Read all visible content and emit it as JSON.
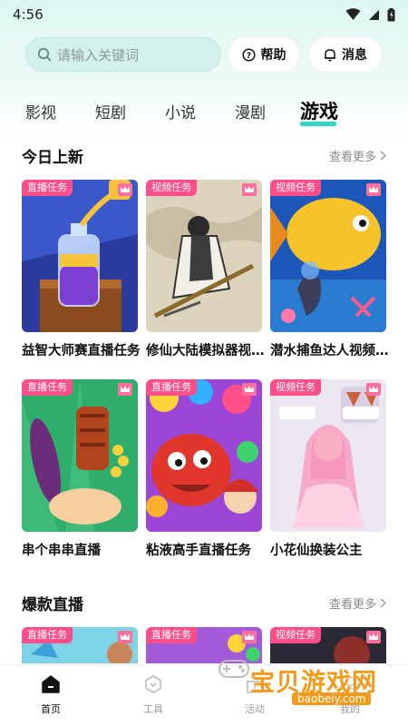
{
  "status_bar": {
    "time": "4:56"
  },
  "search": {
    "placeholder": "请输入关键词"
  },
  "header_buttons": {
    "help_label": "帮助",
    "messages_label": "消息"
  },
  "category_tabs": [
    {
      "label": "影视"
    },
    {
      "label": "短剧"
    },
    {
      "label": "小说"
    },
    {
      "label": "漫剧"
    },
    {
      "label": "游戏"
    }
  ],
  "active_tab": "游戏",
  "sections": {
    "new_today": {
      "title": "今日上新",
      "more_label": "查看更多",
      "cards": [
        {
          "badge": "直播任务",
          "title": "益智大师赛直播任务",
          "icon": "puzzle-bottle-art"
        },
        {
          "badge": "视频任务",
          "title": "修仙大陆模拟器视频任务",
          "icon": "cultivator-art"
        },
        {
          "badge": "视频任务",
          "title": "潜水捕鱼达人视频任务",
          "icon": "fish-diver-art"
        },
        {
          "badge": "直播任务",
          "title": "串个串串直播",
          "icon": "skewer-art"
        },
        {
          "badge": "直播任务",
          "title": "粘液高手直播任务",
          "icon": "slime-monster-art"
        },
        {
          "badge": "视频任务",
          "title": "小花仙换装公主",
          "icon": "fairy-princess-art"
        }
      ]
    },
    "hot_live": {
      "title": "爆款直播",
      "more_label": "查看更多",
      "cards": [
        {
          "badge": "直播任务"
        },
        {
          "badge": "直播任务"
        },
        {
          "badge": "视频任务"
        }
      ]
    }
  },
  "bottom_nav": [
    {
      "label": "首页",
      "icon": "home-icon"
    },
    {
      "label": "工具",
      "icon": "tools-icon"
    },
    {
      "label": "活动",
      "icon": "gift-icon"
    },
    {
      "label": "我的",
      "icon": "profile-icon"
    }
  ],
  "watermark": {
    "text": "宝贝游戏网",
    "url": "baobeiy.com"
  },
  "colors": {
    "accent": "#34d3c3",
    "badge": "#ff4f8a",
    "search_bg": "#d3f1ec",
    "watermark": "#f39a1b"
  }
}
